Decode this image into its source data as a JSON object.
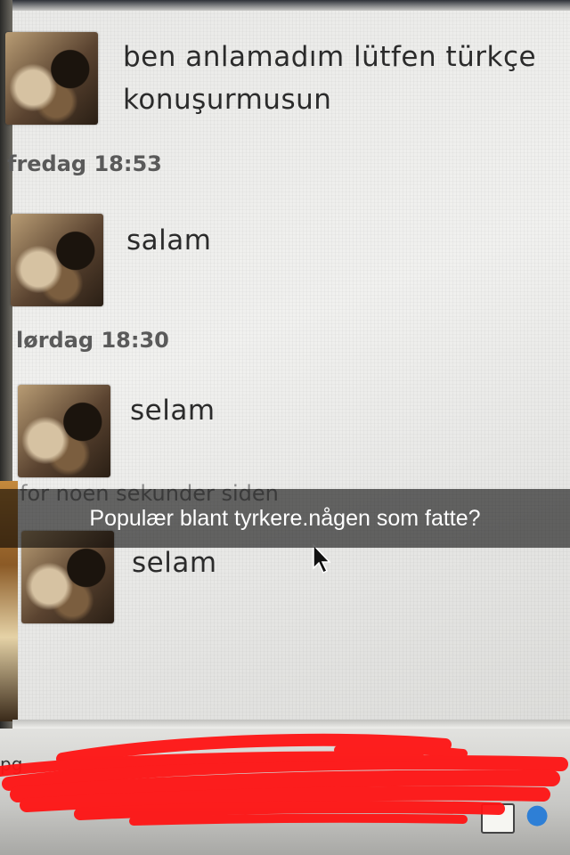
{
  "messages": [
    {
      "lines": [
        "ben anlamadım lütfen türkçe",
        "konuşurmusun"
      ]
    },
    {
      "timestamp": "fredag 18:53",
      "text": "salam"
    },
    {
      "timestamp": "lørdag 18:30",
      "text": "selam"
    },
    {
      "timestamp": "for noen sekunder siden",
      "text": "selam"
    }
  ],
  "caption": "Populær blant tyrkere.någen som fatte?",
  "bottom_bar": {
    "partial_text": "pg"
  },
  "colors": {
    "caption_bg": "#000000",
    "scribble": "#ff1414",
    "text": "#2b2b2b"
  },
  "icons": [
    "avatar",
    "mouse-cursor-icon",
    "notes-icon",
    "chat-icon"
  ]
}
